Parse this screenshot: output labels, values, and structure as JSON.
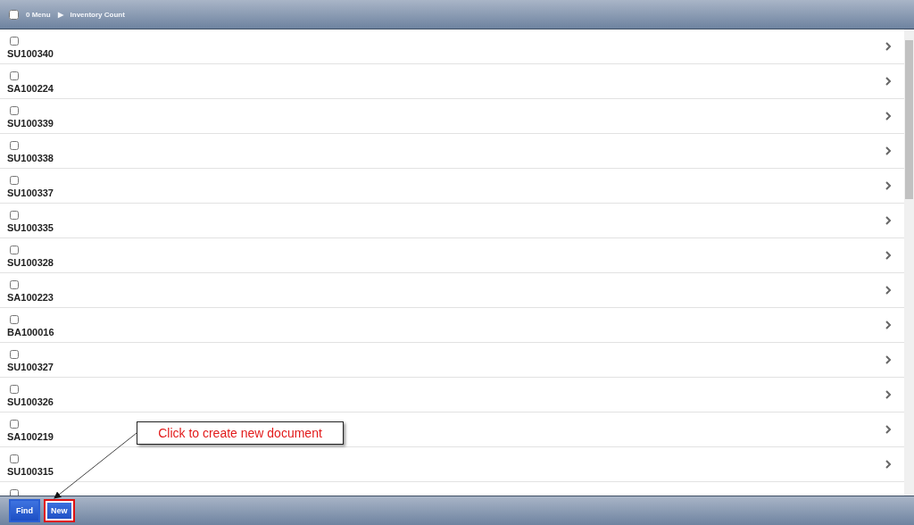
{
  "header": {
    "checked": false,
    "menu_label": "0 Menu",
    "separator": "▶",
    "title": "Inventory Count"
  },
  "rows": [
    {
      "code": "SU100340",
      "checked": false
    },
    {
      "code": "SA100224",
      "checked": false
    },
    {
      "code": "SU100339",
      "checked": false
    },
    {
      "code": "SU100338",
      "checked": false
    },
    {
      "code": "SU100337",
      "checked": false
    },
    {
      "code": "SU100335",
      "checked": false
    },
    {
      "code": "SU100328",
      "checked": false
    },
    {
      "code": "SA100223",
      "checked": false
    },
    {
      "code": "BA100016",
      "checked": false
    },
    {
      "code": "SU100327",
      "checked": false
    },
    {
      "code": "SU100326",
      "checked": false
    },
    {
      "code": "SA100219",
      "checked": false
    },
    {
      "code": "SU100315",
      "checked": false
    },
    {
      "checked": false
    }
  ],
  "footer": {
    "buttons": [
      {
        "label": "Find",
        "highlighted": false
      },
      {
        "label": "New",
        "highlighted": true
      }
    ]
  },
  "annotation": {
    "text": "Click to create new document"
  }
}
